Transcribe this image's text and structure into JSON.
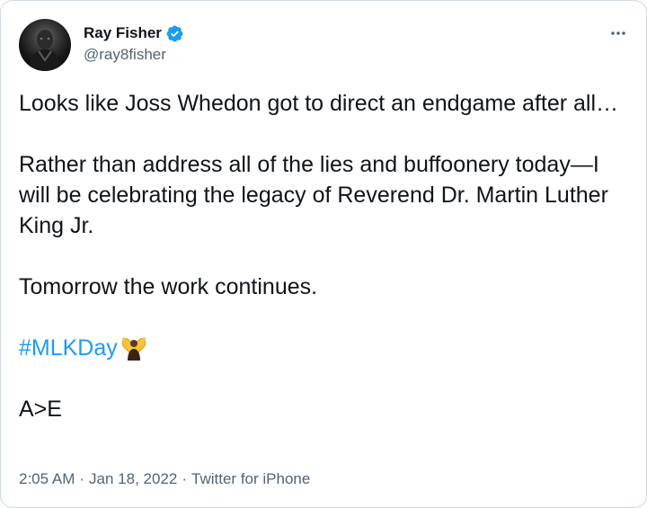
{
  "tweet": {
    "author": {
      "display_name": "Ray Fisher",
      "handle": "@ray8fisher",
      "verified_icon": "verified-badge-icon",
      "avatar": "avatar"
    },
    "more_icon": "ellipsis-icon",
    "body": {
      "paragraph_1": "Looks like Joss Whedon got to direct an endgame after all…",
      "paragraph_2": "Rather than address all of the lies and buffoonery today—I will be celebrating the legacy of Reverend Dr. Martin Luther King Jr.",
      "paragraph_3": "Tomorrow the work continues.",
      "hashtag": "#MLKDay",
      "hashtag_emoji": "raised-hands-icon",
      "paragraph_5": "A>E"
    },
    "meta": {
      "time": "2:05 AM",
      "separator": "·",
      "date": "Jan 18, 2022",
      "source": "Twitter for iPhone"
    }
  },
  "colors": {
    "link": "#1d9bf0",
    "text": "#0f1419",
    "secondary": "#536471",
    "border": "#cfd9de"
  }
}
